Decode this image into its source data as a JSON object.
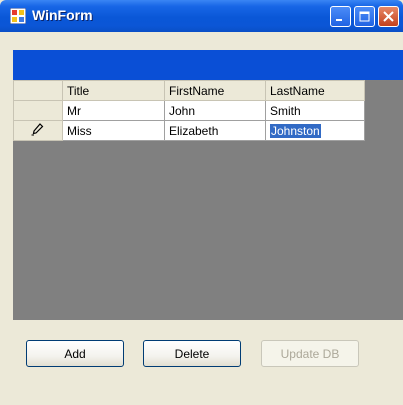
{
  "window": {
    "title": "WinForm"
  },
  "grid": {
    "columns": [
      "Title",
      "FirstName",
      "LastName"
    ],
    "rows": [
      {
        "title": "Mr",
        "first": "John",
        "last": "Smith"
      },
      {
        "title": "Miss",
        "first": "Elizabeth",
        "last": "Johnston"
      }
    ],
    "editing_row_icon": "pencil-icon"
  },
  "buttons": {
    "add": "Add",
    "delete": "Delete",
    "update": "Update DB"
  },
  "colors": {
    "titlebar": "#0a57d7",
    "strip": "#0a4fd6",
    "grid_bg": "#808080",
    "selection": "#316ac5"
  }
}
